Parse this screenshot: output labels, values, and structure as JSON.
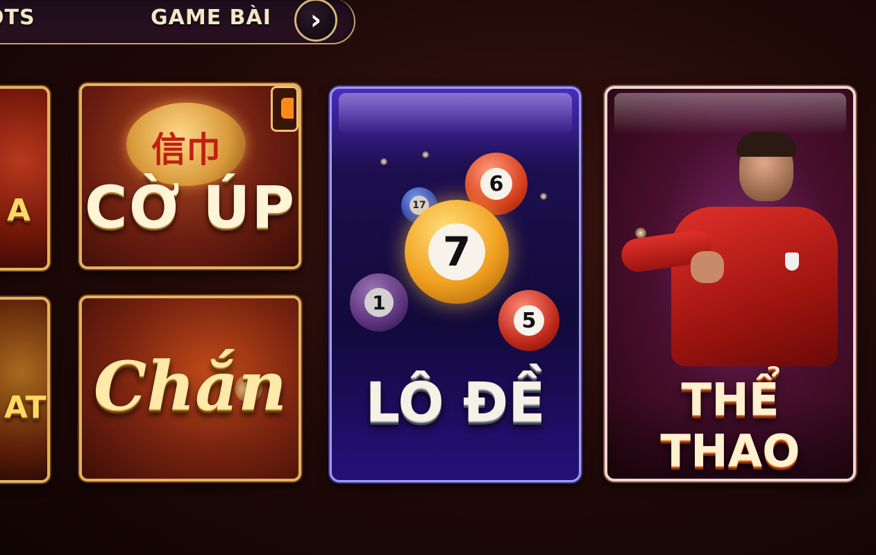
{
  "nav": {
    "tabs": [
      {
        "label": "OTS"
      },
      {
        "label": "GAME BÀI"
      }
    ],
    "next_icon": "chevron-right-icon",
    "next_glyph": "›"
  },
  "cards": {
    "left_top": {
      "text": "A"
    },
    "left_bottom": {
      "text": "AT"
    },
    "coup": {
      "title": "CỜ ÚP",
      "coin_text": "信巾"
    },
    "chan": {
      "title": "Chắn"
    },
    "lode": {
      "title": "LÔ ĐỀ",
      "balls": [
        "7",
        "6",
        "5",
        "1",
        "17"
      ]
    },
    "thethao": {
      "title": "THỂ THAO"
    }
  },
  "colors": {
    "gold_border": "#e3b360",
    "lode_accent": "#4a2bc0",
    "thethao_accent": "#e0302a"
  }
}
